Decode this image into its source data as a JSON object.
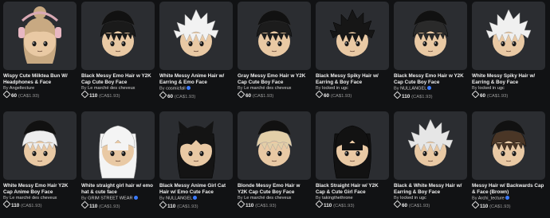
{
  "catalog": {
    "items": [
      {
        "name": "Wispy Cute Milktea Bun W/ Headphones & Face",
        "creator": "Angeltecture",
        "verified": false,
        "price": "60",
        "price_cad": "(CA$1.93)",
        "hair_color": "#c8a982",
        "style": "bun"
      },
      {
        "name": "Black Messy Emo Hair w Y2K Cap Cute Boy Face",
        "creator": "Le marché des cheveux",
        "verified": false,
        "price": "110",
        "price_cad": "(CA$1.93)",
        "hair_color": "#1a1a1a",
        "style": "cap"
      },
      {
        "name": "White Messy Anime Hair w/ Earring & Emo Face",
        "creator": "cosmicfall",
        "verified": true,
        "price": "60",
        "price_cad": "(CA$1.93)",
        "hair_color": "#f2f2f2",
        "style": "messy"
      },
      {
        "name": "Gray Messy Emo Hair w Y2K Cap Cute Boy Face",
        "creator": "Le marché des cheveux",
        "verified": false,
        "price": "60",
        "price_cad": "(CA$1.93)",
        "hair_color": "#1c1c1c",
        "style": "cap"
      },
      {
        "name": "Black Messy Spiky Hair w/ Earring & Boy Face",
        "creator": "locked in ugc",
        "verified": false,
        "price": "60",
        "price_cad": "(CA$1.93)",
        "hair_color": "#161616",
        "style": "messy"
      },
      {
        "name": "Black Messy Emo Hair w Y2K Cap Cute Boy Face",
        "creator": "NULLANGEL",
        "verified": true,
        "price": "110",
        "price_cad": "(CA$1.93)",
        "hair_color": "#2a2a2a",
        "style": "cap"
      },
      {
        "name": "White Messy Spiky Hair w/ Earring & Boy Face",
        "creator": "locked in ugc",
        "verified": false,
        "price": "60",
        "price_cad": "(CA$1.93)",
        "hair_color": "#f0f0f0",
        "style": "messy"
      },
      {
        "name": "White Messy Emo Hair Y2K Cap Anime Boy Face",
        "creator": "Le marché des cheveux",
        "verified": false,
        "price": "110",
        "price_cad": "(CA$1.93)",
        "hair_color": "#eeeeee",
        "style": "cap"
      },
      {
        "name": "White straight girl hair w/ emo hat & cute face",
        "creator": "GRIM STREET WEAR",
        "verified": true,
        "price": "110",
        "price_cad": "(CA$1.93)",
        "hair_color": "#f4f4f4",
        "style": "long"
      },
      {
        "name": "Black Messy Anime Girl Cat Hair w/ Emo Cute Face",
        "creator": "NULLANGEL",
        "verified": true,
        "price": "110",
        "price_cad": "(CA$1.93)",
        "hair_color": "#141414",
        "style": "cat"
      },
      {
        "name": "Blonde Messy Emo Hair w Y2K Cap Cute Boy Face",
        "creator": "Le marché des cheveux",
        "verified": false,
        "price": "110",
        "price_cad": "(CA$1.93)",
        "hair_color": "#e3cfa8",
        "style": "cap"
      },
      {
        "name": "Black Straight Hair w/ Y2K Cap & Cute Girl Face",
        "creator": "takingthethrone",
        "verified": false,
        "price": "110",
        "price_cad": "(CA$1.93)",
        "hair_color": "#121212",
        "style": "long"
      },
      {
        "name": "Black & White Messy Hair w/ Earring & Boy Face",
        "creator": "locked in ugc",
        "verified": false,
        "price": "60",
        "price_cad": "(CA$1.93)",
        "hair_color": "#e6e6e6",
        "style": "messy"
      },
      {
        "name": "Messy Hair w/ Backwards Cap & Face (Brown)",
        "creator": "Archi_tecture",
        "verified": true,
        "price": "110",
        "price_cad": "(CA$1.93)",
        "hair_color": "#4a3626",
        "style": "cap"
      }
    ],
    "by_label": "By"
  }
}
